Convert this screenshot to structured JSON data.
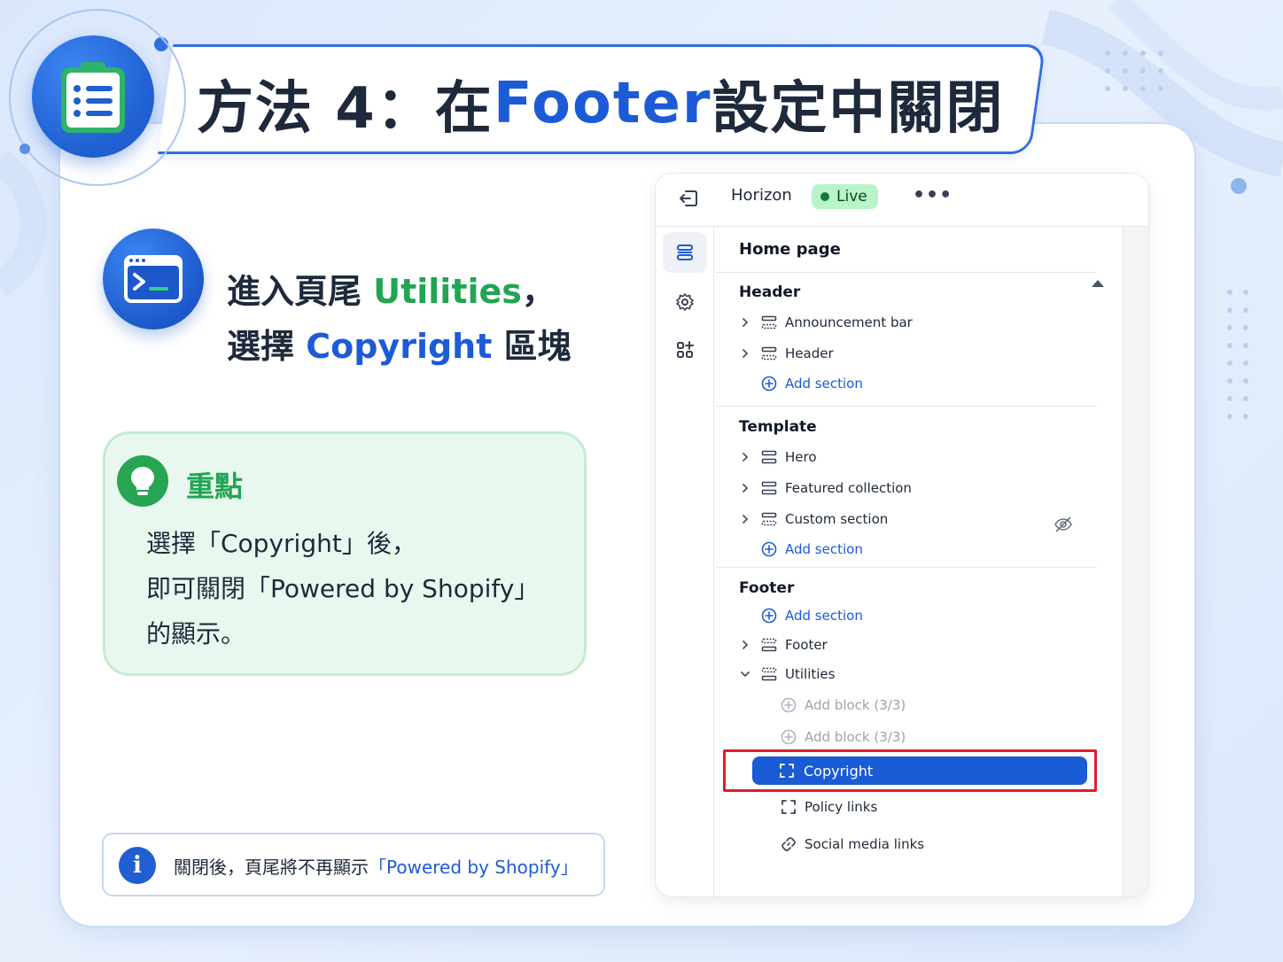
{
  "title": {
    "prefix": "方法 4：在 ",
    "highlight": "Footer",
    "suffix": " 設定中關閉"
  },
  "step": {
    "line1_prefix": "進入頁尾 ",
    "line1_highlight": "Utilities",
    "line1_suffix": "，",
    "line2_prefix": "選擇 ",
    "line2_highlight": "Copyright",
    "line2_suffix": " 區塊"
  },
  "tip": {
    "title": "重點",
    "lines": [
      "選擇「Copyright」後，",
      "即可關閉「Powered by Shopify」",
      "的顯示。"
    ]
  },
  "info": {
    "prefix": "關閉後，頁尾將不再顯示",
    "highlight": "「Powered by Shopify」"
  },
  "panel": {
    "theme_name": "Horizon",
    "status": "Live",
    "more": "•••",
    "page": "Home page",
    "groups": {
      "header": {
        "title": "Header",
        "items": [
          "Announcement bar",
          "Header"
        ],
        "add": "Add section"
      },
      "template": {
        "title": "Template",
        "items": [
          "Hero",
          "Featured collection",
          "Custom section"
        ],
        "add": "Add section"
      },
      "footer": {
        "title": "Footer",
        "add": "Add section",
        "items": [
          "Footer",
          "Utilities"
        ],
        "blocks": {
          "add1": "Add block (3/3)",
          "add2": "Add block (3/3)",
          "selected": "Copyright",
          "policy": "Policy links",
          "social": "Social media links"
        }
      }
    }
  },
  "colors": {
    "primary": "#1d5bd6",
    "green": "#23a455",
    "highlight_frame": "#e11d2a",
    "live_bg": "#b9f3c8"
  }
}
